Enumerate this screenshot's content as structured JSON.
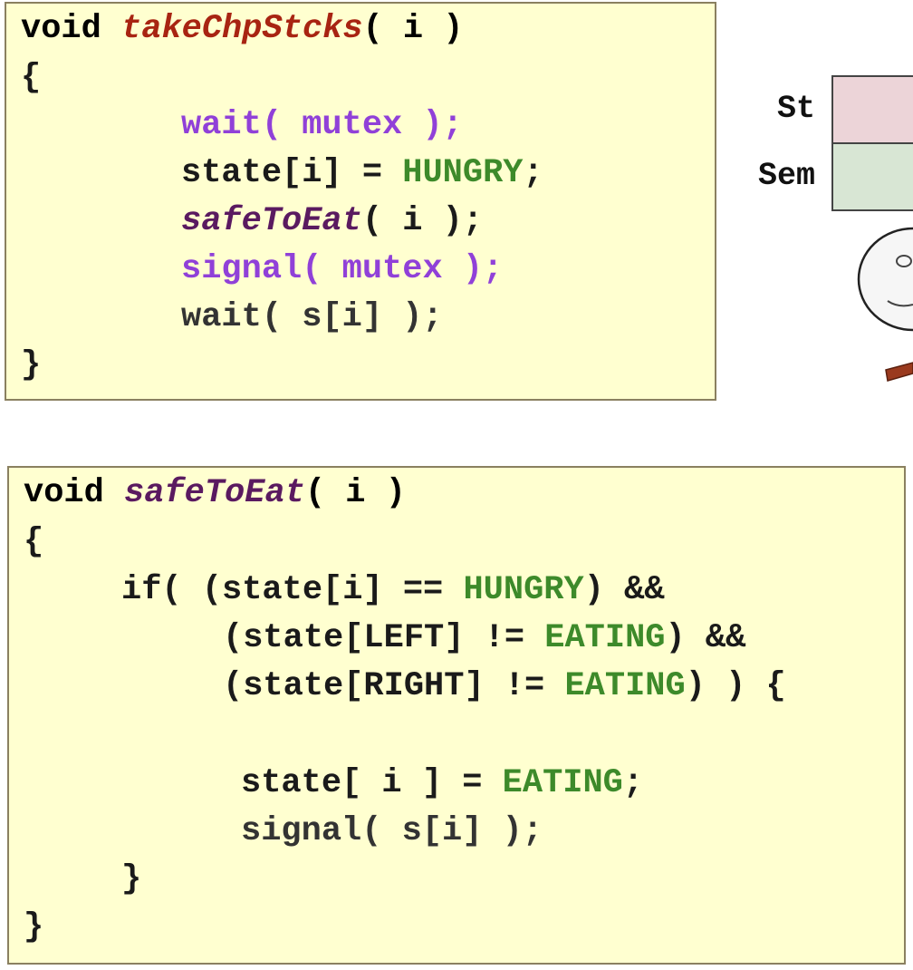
{
  "take_chopsticks": {
    "l1_void": "void ",
    "l1_name": "takeChpStcks",
    "l1_args": "( i )",
    "l2": "{",
    "l3": "wait( mutex );",
    "l4_a": "state[i] = ",
    "l4_b": "HUNGRY",
    "l4_c": ";",
    "l5_a": "safeToEat",
    "l5_b": "( i );",
    "l6": "signal( mutex );",
    "l7": "wait( s[i] );",
    "l8": "}"
  },
  "safe_to_eat": {
    "l1_void": "void ",
    "l1_name": "safeToEat",
    "l1_args": "( i )",
    "l2": "{",
    "l3_a": "if( (state[i] == ",
    "l3_b": "HUNGRY",
    "l3_c": ") &&",
    "l4_a": "(state[LEFT] != ",
    "l4_b": "EATING",
    "l4_c": ") &&",
    "l5_a": "(state[RIGHT] != ",
    "l5_b": "EATING",
    "l5_c": ") ) {",
    "l6_a": "state[ i ] = ",
    "l6_b": "EATING",
    "l6_c": ";",
    "l7": "signal( s[i] );",
    "l8": "}",
    "l9": "}"
  },
  "state_table": {
    "st_label": "St",
    "sem_label": "Sem",
    "st_color": "#ecd4d8",
    "sem_color": "#d8e6d4"
  }
}
